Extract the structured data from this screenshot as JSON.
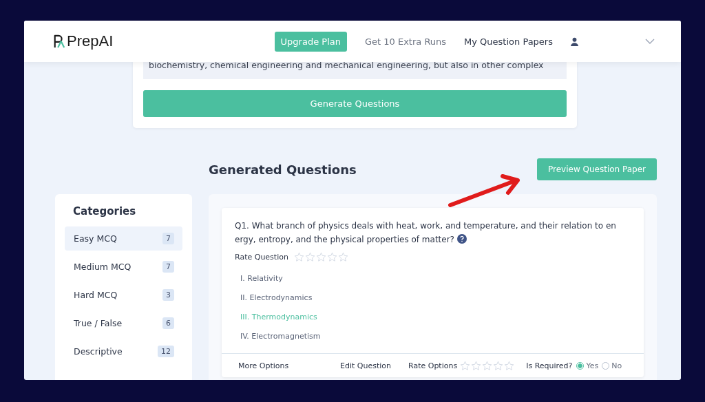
{
  "header": {
    "logo": "PrepAI",
    "nav": [
      {
        "label": "Upgrade Plan",
        "kind": "primary"
      },
      {
        "label": "Get 10 Extra Runs",
        "kind": "muted"
      },
      {
        "label": "My Question Papers",
        "kind": "strong"
      }
    ]
  },
  "input_card": {
    "passage": [
      "biochemistry, chemical engineering and mechanical engineering, but also in other complex"
    ],
    "button": "Generate Questions"
  },
  "section_title": "Generated Questions",
  "preview_button": "Preview Question Paper",
  "categories": {
    "title": "Categories",
    "items": [
      {
        "label": "Easy MCQ",
        "count": "7",
        "selected": true
      },
      {
        "label": "Medium MCQ",
        "count": "7",
        "selected": false
      },
      {
        "label": "Hard MCQ",
        "count": "3",
        "selected": false
      },
      {
        "label": "True / False",
        "count": "6",
        "selected": false
      },
      {
        "label": "Descriptive",
        "count": "12",
        "selected": false
      }
    ]
  },
  "question": {
    "text": "Q1. What branch of physics deals with heat, work, and temperature, and their relation to en ergy, entropy, and the physical properties of matter?",
    "rate_label": "Rate Question",
    "stars": 0,
    "options": [
      {
        "text": "I. Relativity",
        "correct": false
      },
      {
        "text": "II. Electrodynamics",
        "correct": false
      },
      {
        "text": "III. Thermodynamics",
        "correct": true
      },
      {
        "text": "IV. Electromagnetism",
        "correct": false
      }
    ],
    "footer": {
      "more_options": "More Options",
      "edit_question": "Edit Question",
      "rate_options": {
        "label": "Rate Options",
        "stars": 0
      },
      "required_label": "Is Required?",
      "choices": [
        {
          "label": "Yes",
          "selected": true
        },
        {
          "label": "No",
          "selected": false
        }
      ]
    }
  }
}
